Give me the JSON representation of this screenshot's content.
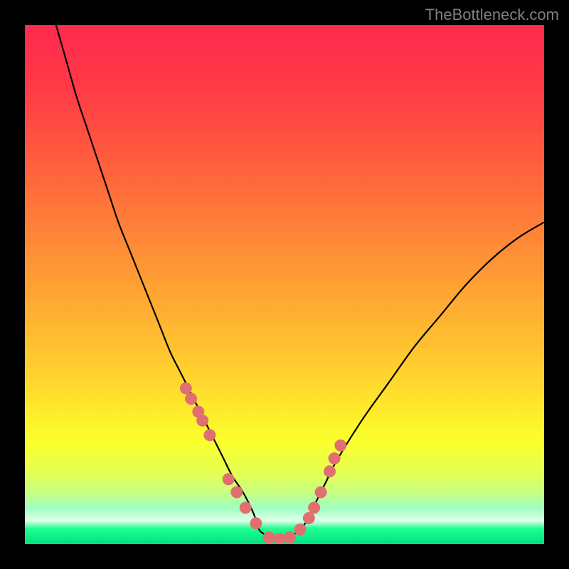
{
  "watermark": "TheBottleneck.com",
  "colors": {
    "frame": "#000000",
    "curve": "#000000",
    "marker": "#E07070",
    "watermark": "#808080"
  },
  "gradient": {
    "type": "linear-vertical",
    "stops": [
      {
        "offset": 0.0,
        "color": "#FF2A4D"
      },
      {
        "offset": 0.12,
        "color": "#FF3A46"
      },
      {
        "offset": 0.25,
        "color": "#FF5A3E"
      },
      {
        "offset": 0.38,
        "color": "#FF7E38"
      },
      {
        "offset": 0.5,
        "color": "#FFA033"
      },
      {
        "offset": 0.62,
        "color": "#FFC22F"
      },
      {
        "offset": 0.72,
        "color": "#FFE22C"
      },
      {
        "offset": 0.8,
        "color": "#FBFF2C"
      },
      {
        "offset": 0.86,
        "color": "#E6FF50"
      },
      {
        "offset": 0.9,
        "color": "#C8FF80"
      },
      {
        "offset": 0.93,
        "color": "#A0FFC0"
      },
      {
        "offset": 0.955,
        "color": "#E0FFE8"
      },
      {
        "offset": 0.97,
        "color": "#20FF90"
      },
      {
        "offset": 1.0,
        "color": "#00E080"
      }
    ]
  },
  "chart_data": {
    "type": "line",
    "title": "",
    "xlabel": "",
    "ylabel": "",
    "xlim": [
      0,
      100
    ],
    "ylim": [
      0,
      100
    ],
    "series": [
      {
        "name": "bottleneck-curve",
        "x": [
          6,
          8,
          10,
          12,
          14,
          16,
          18,
          20,
          22,
          24,
          26,
          28,
          30,
          32,
          34,
          36,
          38,
          40,
          42,
          44,
          45,
          46,
          48,
          50,
          52,
          54,
          56,
          58,
          60,
          65,
          70,
          75,
          80,
          85,
          90,
          95,
          100
        ],
        "y": [
          100,
          93,
          86,
          80,
          74,
          68,
          62,
          57,
          52,
          47,
          42,
          37,
          33,
          29,
          25,
          21,
          17,
          13,
          10,
          6,
          3,
          2,
          1,
          1,
          2,
          4,
          8,
          12,
          16,
          24,
          31,
          38,
          44,
          50,
          55,
          59,
          62
        ]
      }
    ],
    "markers": {
      "name": "data-points",
      "x": [
        31.0,
        32.0,
        33.4,
        34.2,
        35.6,
        39.2,
        40.8,
        42.5,
        44.5,
        47.0,
        49.0,
        51.0,
        53.0,
        54.7,
        55.7,
        57.0,
        58.7,
        59.6,
        60.8
      ],
      "y": [
        30.0,
        28.0,
        25.5,
        23.8,
        21.0,
        12.5,
        10.0,
        7.0,
        4.0,
        1.3,
        1.0,
        1.3,
        2.8,
        5.0,
        7.0,
        10.0,
        14.0,
        16.5,
        19.0
      ]
    }
  }
}
